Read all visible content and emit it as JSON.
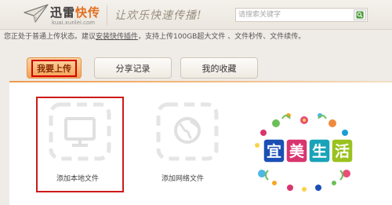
{
  "header": {
    "brand_main": "迅雷",
    "brand_accent": "快传",
    "brand_url": "kuai.xunlei.com",
    "slogan": "让欢乐快速传播!",
    "search_placeholder": "请搜索关键字"
  },
  "info": {
    "prefix": "您正处于普通上传状态。建议",
    "link": "安装快传插件",
    "suffix": "，支持上传100GB超大文件 、文件秒传、文件续传。"
  },
  "tabs": [
    {
      "label": "我要上传",
      "active": true
    },
    {
      "label": "分享记录",
      "active": false
    },
    {
      "label": "我的收藏",
      "active": false
    }
  ],
  "upload_options": [
    {
      "label": "添加本地文件",
      "icon": "monitor-icon",
      "selected": true
    },
    {
      "label": "添加网络文件",
      "icon": "globe-icon",
      "selected": false
    }
  ],
  "promo": {
    "text": "宜美生活",
    "letters": [
      "宜",
      "美",
      "生",
      "活"
    ],
    "colors": [
      "#1a4fb4",
      "#d8356e",
      "#18a3b8",
      "#9ac21f"
    ]
  },
  "colors": {
    "accent_orange": "#e2701f",
    "tab_active": "#f5a355",
    "highlight_red": "#cc1a1a"
  }
}
